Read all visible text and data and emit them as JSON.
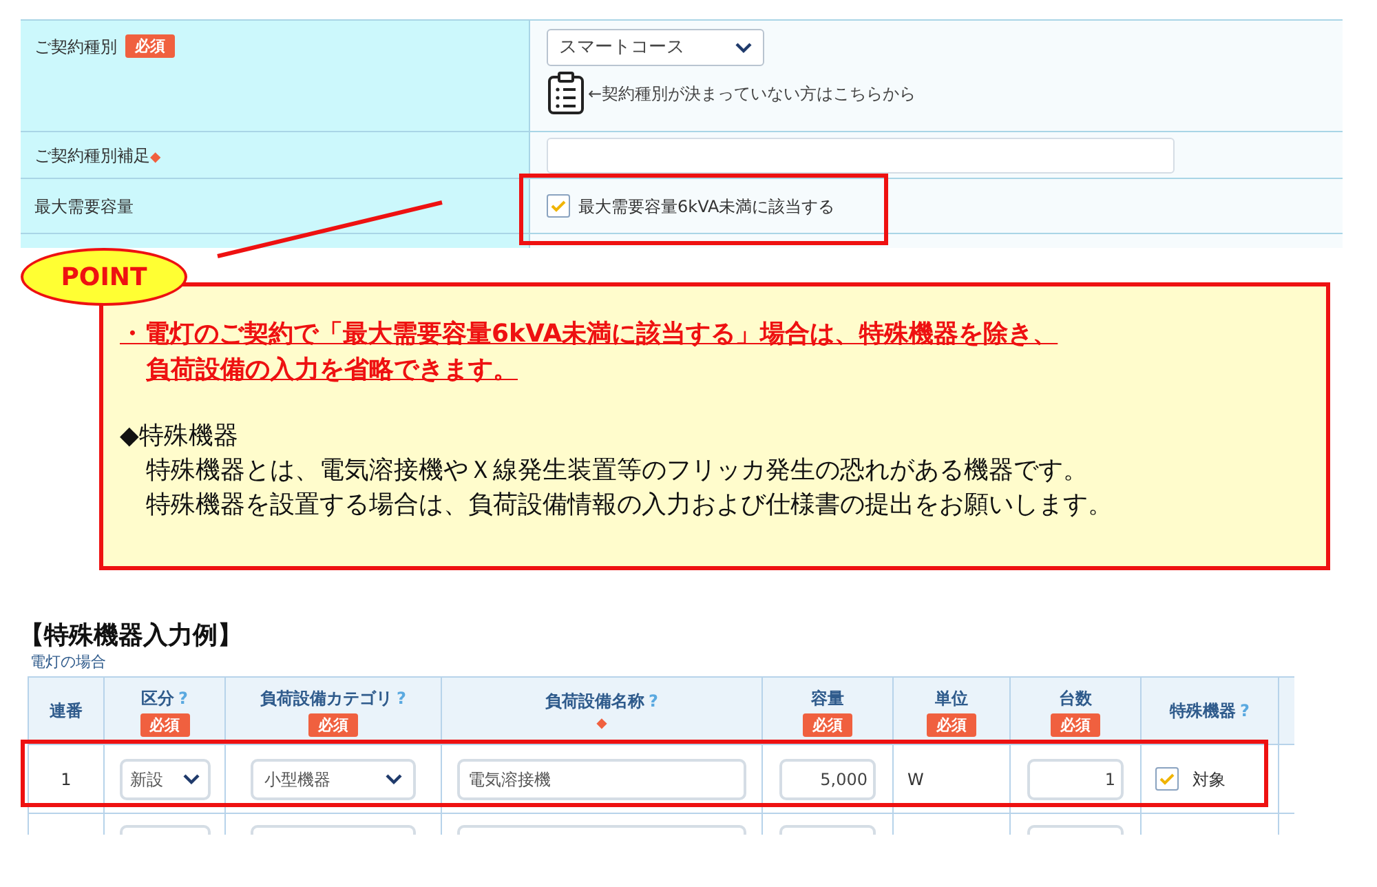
{
  "contract_form": {
    "contract_type": {
      "label": "ご契約種別",
      "badge": "必須",
      "value": "スマートコース",
      "helper": "←契約種別が決まっていない方はこちらから"
    },
    "contract_note": {
      "label": "ご契約種別補足",
      "required_mark": "◆"
    },
    "max_demand": {
      "label": "最大需要容量",
      "checkbox_label": "最大需要容量6kVA未満に該当する",
      "checked": true
    }
  },
  "point": {
    "badge": "POINT",
    "highlight_lines": [
      "・電灯のご契約で「最大需要容量6kVA未満に該当する」場合は、特殊機器を除き、",
      "負荷設備の入力を省略できます。"
    ],
    "heading": "◆特殊機器",
    "body_lines": [
      "特殊機器とは、電気溶接機やＸ線発生装置等のフリッカ発生の恐れがある機器です。",
      "特殊機器を設置する場合は、負荷設備情報の入力および仕様書の提出をお願いします。"
    ]
  },
  "example": {
    "title": "【特殊機器入力例】",
    "caption": "電灯の場合",
    "columns": [
      {
        "label": "連番"
      },
      {
        "label": "区分",
        "help": "?",
        "badge": "必須"
      },
      {
        "label": "負荷設備カテゴリ",
        "help": "?",
        "badge": "必須"
      },
      {
        "label": "負荷設備名称",
        "help": "?",
        "mark": "◆"
      },
      {
        "label": "容量",
        "badge": "必須"
      },
      {
        "label": "単位",
        "badge": "必須"
      },
      {
        "label": "台数",
        "badge": "必須"
      },
      {
        "label": "特殊機器",
        "help": "?"
      }
    ],
    "rows": [
      {
        "no": "1",
        "division": "新設",
        "category": "小型機器",
        "name": "電気溶接機",
        "capacity": "5,000",
        "unit": "W",
        "count": "1",
        "special_label": "対象",
        "checked": true
      }
    ]
  }
}
